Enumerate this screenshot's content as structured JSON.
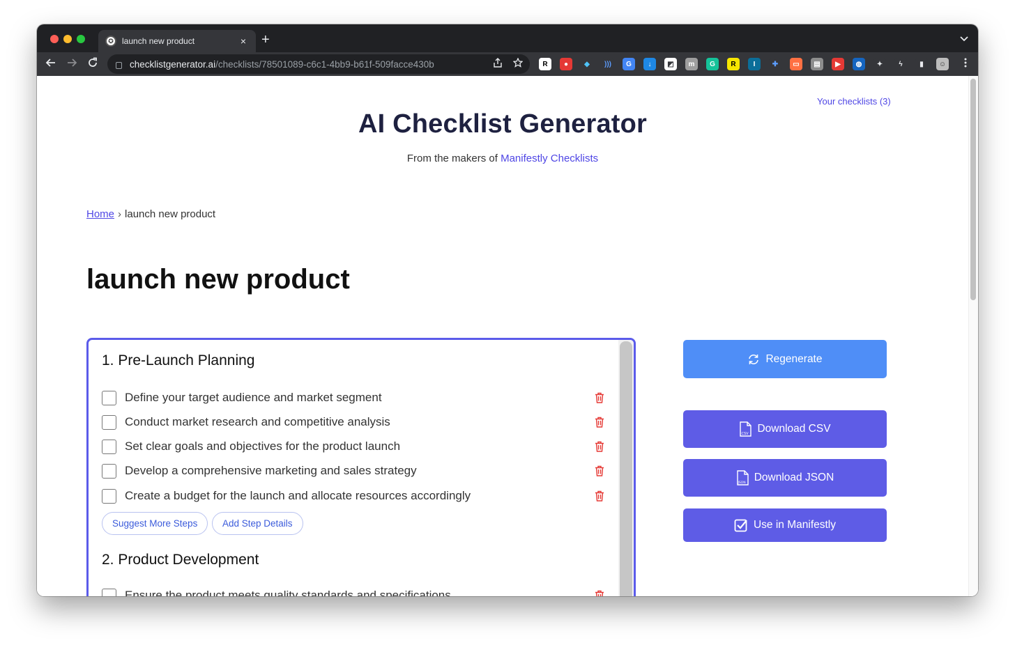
{
  "browser": {
    "tab_title": "launch new product",
    "tab_favicon_glyph": "✪",
    "tab_close": "×",
    "new_tab": "+",
    "url_host": "checklistgenerator.ai",
    "url_path": "/checklists/78501089-c6c1-4bb9-b61f-509facce430b",
    "extensions": [
      {
        "label": "R",
        "color": "#ffffff",
        "text_color": "#000000"
      },
      {
        "label": "●",
        "color": "#e53935",
        "text_color": "#ffffff"
      },
      {
        "label": "◆",
        "color": "#35363a",
        "text_color": "#4fc3f7"
      },
      {
        "label": ")))",
        "color": "#35363a",
        "text_color": "#5c9dff"
      },
      {
        "label": "G",
        "color": "#4285f4",
        "text_color": "#ffffff"
      },
      {
        "label": "↓",
        "color": "#1e88e5",
        "text_color": "#ffffff"
      },
      {
        "label": "◩",
        "color": "#ffffff",
        "text_color": "#35363a"
      },
      {
        "label": "m",
        "color": "#9e9e9e",
        "text_color": "#ffffff"
      },
      {
        "label": "G",
        "color": "#15c39a",
        "text_color": "#ffffff"
      },
      {
        "label": "R",
        "color": "#f7e600",
        "text_color": "#000000"
      },
      {
        "label": "I",
        "color": "#0b6e99",
        "text_color": "#ffffff"
      },
      {
        "label": "✚",
        "color": "#35363a",
        "text_color": "#5c9dff"
      },
      {
        "label": "▭",
        "color": "#ff7043",
        "text_color": "#ffffff"
      },
      {
        "label": "▤",
        "color": "#8d8d8d",
        "text_color": "#ffffff"
      },
      {
        "label": "▶",
        "color": "#e53935",
        "text_color": "#ffffff"
      },
      {
        "label": "◍",
        "color": "#1565c0",
        "text_color": "#ffffff"
      },
      {
        "label": "✦",
        "color": "#35363a",
        "text_color": "#e8eaed"
      },
      {
        "label": "ϟ",
        "color": "#35363a",
        "text_color": "#e8eaed"
      },
      {
        "label": "▮",
        "color": "#35363a",
        "text_color": "#e8eaed"
      },
      {
        "label": "☺",
        "color": "#bdbdbd",
        "text_color": "#333333"
      }
    ]
  },
  "header": {
    "your_checklists": "Your checklists (3)",
    "title": "AI Checklist Generator",
    "subtitle_prefix": "From the makers of ",
    "subtitle_link": "Manifestly Checklists"
  },
  "breadcrumb": {
    "home": "Home",
    "separator": "›",
    "current": "launch new product"
  },
  "page_title": "launch new product",
  "checklist": {
    "sections": [
      {
        "title": "1. Pre-Launch Planning",
        "steps": [
          "Define your target audience and market segment",
          "Conduct market research and competitive analysis",
          "Set clear goals and objectives for the product launch",
          "Develop a comprehensive marketing and sales strategy",
          "Create a budget for the launch and allocate resources accordingly"
        ],
        "actions": [
          "Suggest More Steps",
          "Add Step Details"
        ]
      },
      {
        "title": "2. Product Development",
        "steps": [
          "Ensure the product meets quality standards and specifications"
        ]
      }
    ]
  },
  "actions": {
    "regenerate": "Regenerate",
    "download_csv": "Download CSV",
    "download_json": "Download JSON",
    "use_in_manifestly": "Use in Manifestly"
  },
  "colors": {
    "accent": "#4f46e5",
    "regenerate_button": "#4f8ef7",
    "primary_button": "#5e5ce6",
    "panel_border": "#5b5bea",
    "trash": "#e53935"
  }
}
